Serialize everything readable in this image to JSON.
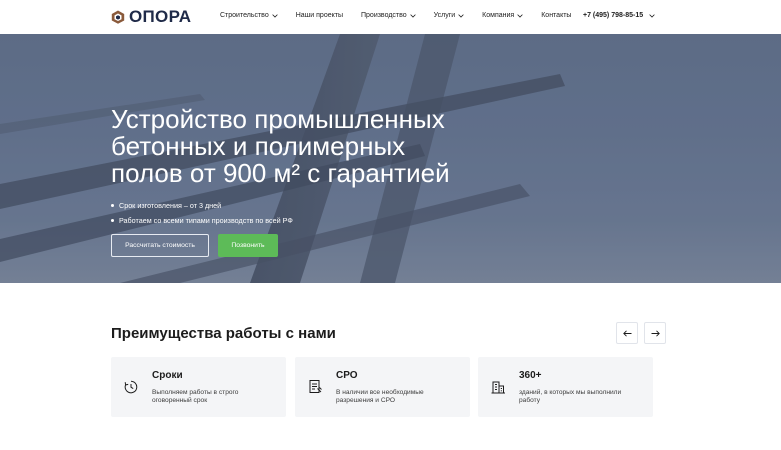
{
  "header": {
    "logo_text": "ОПОРА",
    "nav": [
      {
        "label": "Строительство",
        "has_dropdown": true
      },
      {
        "label": "Наши проекты",
        "has_dropdown": false
      },
      {
        "label": "Производство",
        "has_dropdown": true
      },
      {
        "label": "Услуги",
        "has_dropdown": true
      },
      {
        "label": "Компания",
        "has_dropdown": true
      },
      {
        "label": "Контакты",
        "has_dropdown": false
      }
    ],
    "phone": "+7 (495) 798-85-15"
  },
  "hero": {
    "title_lines": [
      "Устройство промышленных",
      "бетонных и полимерных",
      "полов от 900 м² с гарантией"
    ],
    "bullets": [
      "Срок изготовления – от 3 дней",
      "Работаем со всеми типами производств по всей РФ"
    ],
    "btn_calc": "Рассчитать стоимость",
    "btn_call": "Позвонить"
  },
  "advantages": {
    "title": "Преимущества работы с нами",
    "cards": [
      {
        "icon": "clock-icon",
        "title": "Сроки",
        "desc_lines": [
          "Выполняем работы в строго",
          "оговоренный срок"
        ]
      },
      {
        "icon": "document-icon",
        "title": "СРО",
        "desc_lines": [
          "В наличии все необходимые",
          "разрешения и СРО"
        ]
      },
      {
        "icon": "building-icon",
        "title": "360+",
        "desc_lines": [
          "зданий, в которых мы выполнили",
          "работу"
        ]
      }
    ]
  },
  "colors": {
    "accent_green": "#5dbb58",
    "logo_navy": "#1f2a48",
    "logo_brown": "#8a5a3b",
    "card_bg": "#f4f5f7"
  }
}
